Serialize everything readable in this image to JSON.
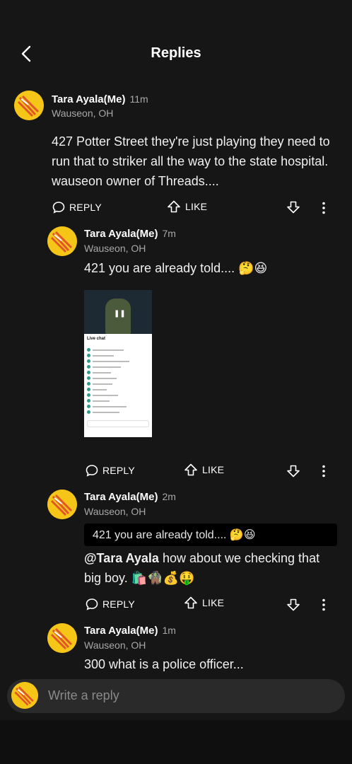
{
  "header": {
    "title": "Replies",
    "back_icon": "chevron-left-icon"
  },
  "comments": [
    {
      "author": "Tara Ayala(Me)",
      "time": "11m",
      "location": "Wauseon, OH",
      "text": "427 Potter Street they're just playing they need to run that to striker all the way to the state hospital. wauseon owner of Threads....",
      "reply_label": "REPLY",
      "like_label": "LIKE"
    },
    {
      "author": "Tara Ayala(Me)",
      "time": "7m",
      "location": "Wauseon, OH",
      "text": "421 you are already told.... 🤔😆",
      "media": {
        "chat_title": "Live chat"
      },
      "reply_label": "REPLY",
      "like_label": "LIKE"
    },
    {
      "author": "Tara Ayala(Me)",
      "time": "2m",
      "location": "Wauseon, OH",
      "quote": "421 you are already told.... 🤔😆",
      "mention": "@Tara Ayala",
      "text": " how about we checking that big boy. 🛍️🧌💰🤑",
      "reply_label": "REPLY",
      "like_label": "LIKE"
    },
    {
      "author": "Tara Ayala(Me)",
      "time": "1m",
      "location": "Wauseon, OH",
      "text": "300 what is a police officer..."
    }
  ],
  "composer": {
    "placeholder": "Write a reply"
  },
  "colors": {
    "background": "#161616",
    "avatar": "#f5c518",
    "muted": "#a8a8a8"
  }
}
